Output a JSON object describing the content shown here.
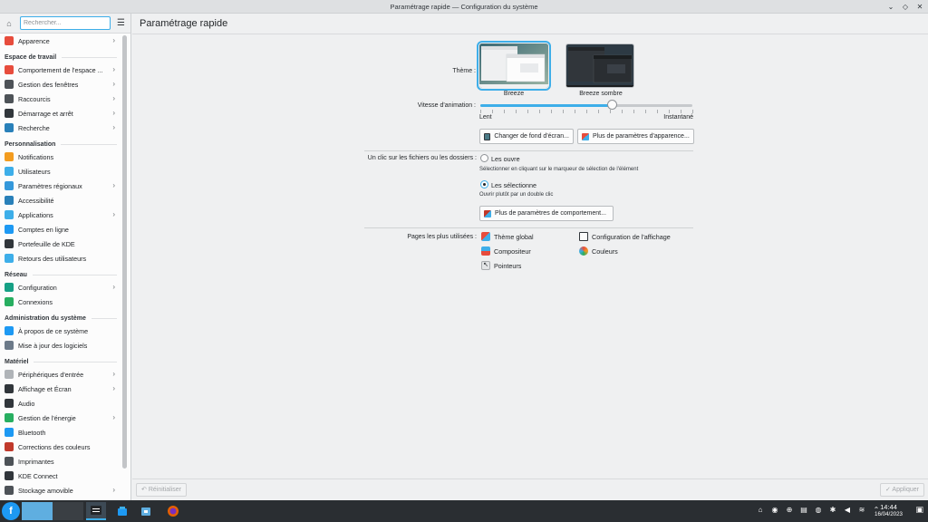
{
  "window": {
    "title": "Paramétrage rapide — Configuration du système",
    "controls": [
      "chevron-down-icon",
      "restore-icon",
      "close-icon"
    ]
  },
  "sidebar": {
    "search_placeholder": "Rechercher...",
    "top_items": [
      {
        "label": "Apparence",
        "icon": "appearance-icon",
        "color": "#e74c3c",
        "has_children": true
      }
    ],
    "sections": [
      {
        "heading": "Espace de travail",
        "items": [
          {
            "label": "Comportement de l'espace ...",
            "icon": "workspace-icon",
            "color": "#e74c3c",
            "has_children": true
          },
          {
            "label": "Gestion des fenêtres",
            "icon": "window-icon",
            "color": "#4d5257",
            "has_children": true
          },
          {
            "label": "Raccourcis",
            "icon": "keyboard-icon",
            "color": "#4d5257",
            "has_children": true
          },
          {
            "label": "Démarrage et arrêt",
            "icon": "startup-icon",
            "color": "#31363b",
            "has_children": true
          },
          {
            "label": "Recherche",
            "icon": "search-icon",
            "color": "#2980b9",
            "has_children": true
          }
        ]
      },
      {
        "heading": "Personnalisation",
        "items": [
          {
            "label": "Notifications",
            "icon": "bell-icon",
            "color": "#f39c1f",
            "has_children": false
          },
          {
            "label": "Utilisateurs",
            "icon": "users-icon",
            "color": "#3daee9",
            "has_children": false
          },
          {
            "label": "Paramètres régionaux",
            "icon": "region-icon",
            "color": "#3498db",
            "has_children": true
          },
          {
            "label": "Accessibilité",
            "icon": "accessibility-icon",
            "color": "#2980b9",
            "has_children": false
          },
          {
            "label": "Applications",
            "icon": "apps-icon",
            "color": "#3daee9",
            "has_children": true
          },
          {
            "label": "Comptes en ligne",
            "icon": "online-accounts-icon",
            "color": "#1d99f3",
            "has_children": false
          },
          {
            "label": "Portefeuille de KDE",
            "icon": "wallet-icon",
            "color": "#31363b",
            "has_children": false
          },
          {
            "label": "Retours des utilisateurs",
            "icon": "feedback-icon",
            "color": "#3daee9",
            "has_children": false
          }
        ]
      },
      {
        "heading": "Réseau",
        "items": [
          {
            "label": "Configuration",
            "icon": "network-settings-icon",
            "color": "#16a085",
            "has_children": true
          },
          {
            "label": "Connexions",
            "icon": "connections-icon",
            "color": "#27ae60",
            "has_children": false
          }
        ]
      },
      {
        "heading": "Administration du système",
        "items": [
          {
            "label": "À propos de ce système",
            "icon": "info-icon",
            "color": "#1d99f3",
            "has_children": false
          },
          {
            "label": "Mise à jour des logiciels",
            "icon": "update-icon",
            "color": "#6c7a89",
            "has_children": false
          }
        ]
      },
      {
        "heading": "Matériel",
        "items": [
          {
            "label": "Périphériques d'entrée",
            "icon": "mouse-icon",
            "color": "#b0b4b8",
            "has_children": true
          },
          {
            "label": "Affichage et Écran",
            "icon": "display-icon",
            "color": "#31363b",
            "has_children": true
          },
          {
            "label": "Audio",
            "icon": "audio-icon",
            "color": "#31363b",
            "has_children": false
          },
          {
            "label": "Gestion de l'énergie",
            "icon": "power-icon",
            "color": "#27ae60",
            "has_children": true
          },
          {
            "label": "Bluetooth",
            "icon": "bluetooth-icon",
            "color": "#1d99f3",
            "has_children": false
          },
          {
            "label": "Corrections des couleurs",
            "icon": "color-correction-icon",
            "color": "#c0392b",
            "has_children": false
          },
          {
            "label": "Imprimantes",
            "icon": "printer-icon",
            "color": "#4d5257",
            "has_children": false
          },
          {
            "label": "KDE Connect",
            "icon": "phone-icon",
            "color": "#31363b",
            "has_children": false
          },
          {
            "label": "Stockage amovible",
            "icon": "usb-icon",
            "color": "#4d5257",
            "has_children": true
          }
        ]
      }
    ]
  },
  "main": {
    "title": "Paramétrage rapide",
    "theme": {
      "label": "Thème :",
      "options": [
        {
          "name": "Breeze",
          "selected": true
        },
        {
          "name": "Breeze sombre",
          "selected": false
        }
      ]
    },
    "animation": {
      "label": "Vitesse d'animation :",
      "min_label": "Lent",
      "max_label": "Instantané",
      "value_fraction": 0.62
    },
    "buttons": {
      "wallpaper": "Changer de fond d'écran...",
      "more_appearance": "Plus de paramètres d'apparence...",
      "more_behavior": "Plus de paramètres de comportement..."
    },
    "click": {
      "label": "Un clic sur les fichiers ou les dossiers :",
      "options": [
        {
          "label": "Les ouvre",
          "hint": "Sélectionner en cliquant sur le marqueur de sélection de l'élément",
          "selected": false
        },
        {
          "label": "Les sélectionne",
          "hint": "Ouvrir plutôt par un double clic",
          "selected": true
        }
      ]
    },
    "most_used": {
      "label": "Pages les plus utilisées :",
      "pages": [
        {
          "label": "Thème global",
          "icon": "global-theme-icon",
          "color": "#e74c3c"
        },
        {
          "label": "Configuration de l'affichage",
          "icon": "display-config-icon",
          "color": "#31363b"
        },
        {
          "label": "Compositeur",
          "icon": "compositor-icon",
          "color": "#3daee9"
        },
        {
          "label": "Couleurs",
          "icon": "colors-icon",
          "color": "#c0392b"
        },
        {
          "label": "Pointeurs",
          "icon": "cursor-icon",
          "color": "#b0b4b8"
        }
      ]
    },
    "footer": {
      "reset": "Réinitialiser",
      "apply": "Appliquer"
    }
  },
  "taskbar": {
    "time": "14:44",
    "date": "16/04/2023"
  },
  "colors": {
    "accent": "#3daee9",
    "panel": "#2a2e32"
  }
}
